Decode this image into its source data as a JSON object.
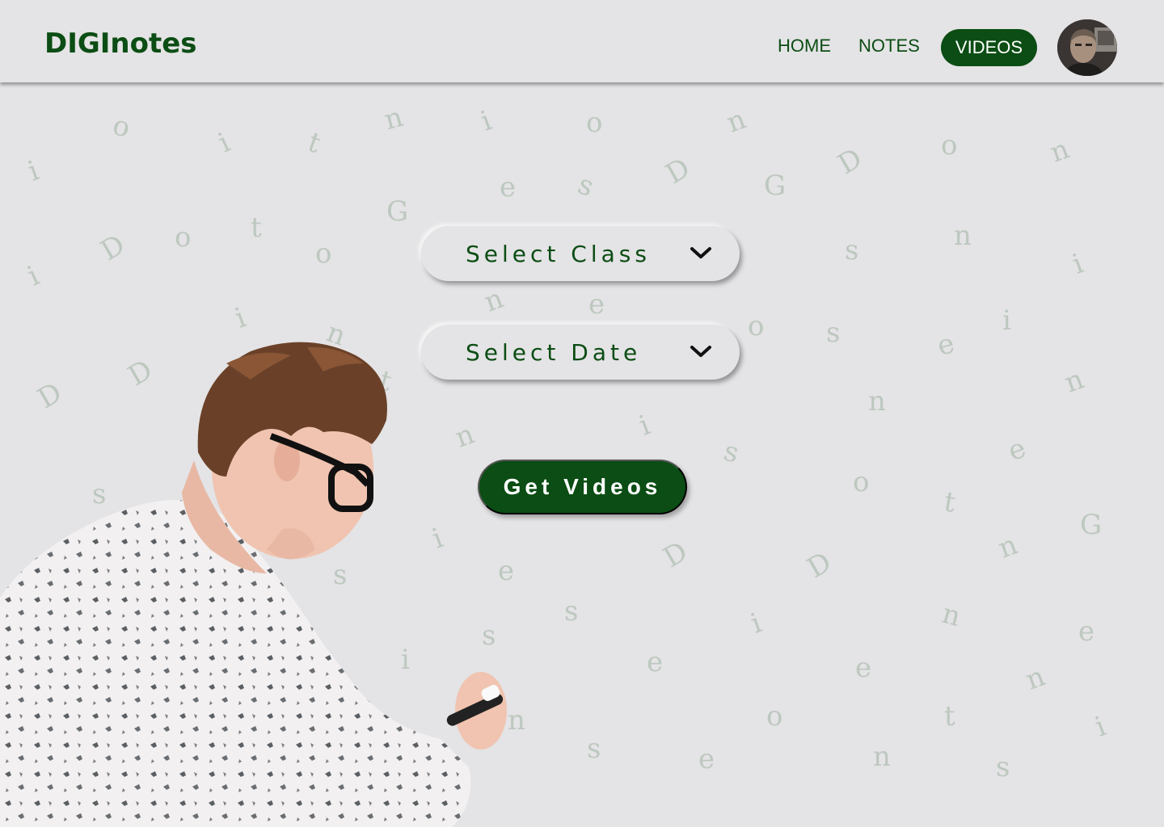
{
  "app": {
    "logo": "DIGInotes"
  },
  "nav": {
    "home": "HOME",
    "notes": "NOTES",
    "videos": "VIDEOS",
    "active": "videos"
  },
  "form": {
    "class_label": "Select Class",
    "date_label": "Select Date",
    "submit_label": "Get Videos"
  },
  "icons": {
    "dropdown": "chevron-down-icon",
    "avatar": "user-avatar"
  },
  "background_letters": [
    "D",
    "i",
    "G",
    "n",
    "o",
    "t",
    "e",
    "s"
  ],
  "colors": {
    "brand": "#0b4d14",
    "background": "#e4e3e5",
    "button_text": "#ffffff"
  }
}
